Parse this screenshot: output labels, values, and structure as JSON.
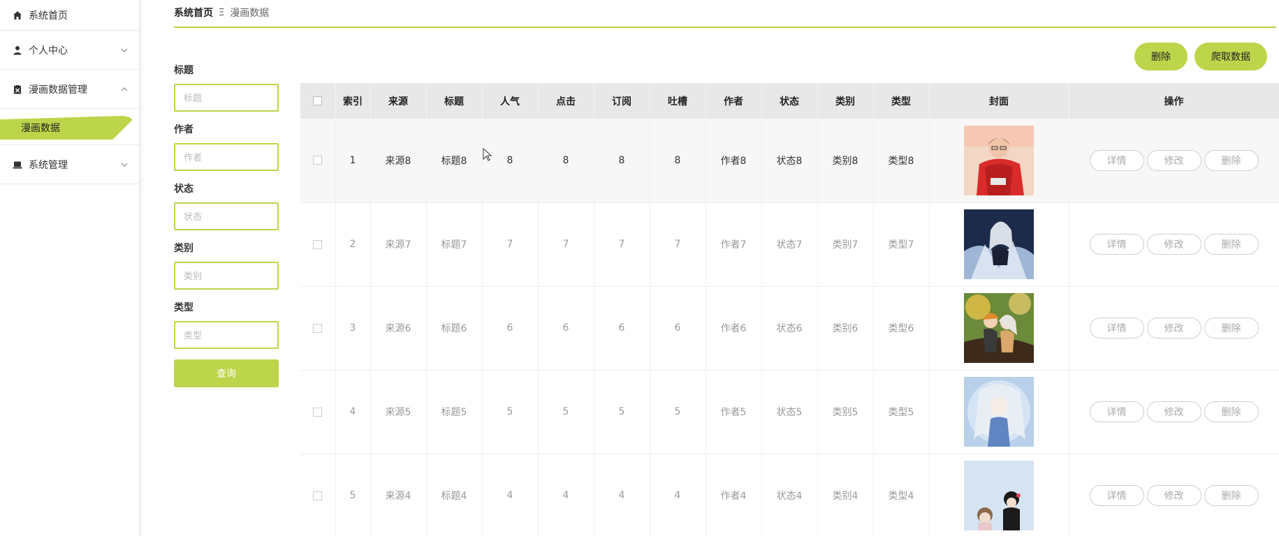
{
  "sidebar": {
    "items": [
      {
        "label": "系统首页",
        "icon": "home-icon"
      },
      {
        "label": "个人中心",
        "icon": "user-icon"
      },
      {
        "label": "漫画数据管理",
        "icon": "clipboard-icon"
      },
      {
        "label": "系统管理",
        "icon": "laptop-icon"
      }
    ],
    "active_sub": "漫画数据"
  },
  "breadcrumb": {
    "home": "系统首页",
    "separator": "Ξ",
    "current": "漫画数据"
  },
  "actions": {
    "delete_label": "删除",
    "crawl_label": "爬取数据"
  },
  "filters": {
    "title": {
      "label": "标题",
      "placeholder": "标题"
    },
    "author": {
      "label": "作者",
      "placeholder": "作者"
    },
    "status": {
      "label": "状态",
      "placeholder": "状态"
    },
    "category": {
      "label": "类别",
      "placeholder": "类别"
    },
    "type": {
      "label": "类型",
      "placeholder": "类型"
    },
    "query_label": "查询"
  },
  "table": {
    "headers": [
      "索引",
      "来源",
      "标题",
      "人气",
      "点击",
      "订阅",
      "吐槽",
      "作者",
      "状态",
      "类别",
      "类型",
      "封面",
      "操作"
    ],
    "rows": [
      {
        "index": "1",
        "source": "来源8",
        "title": "标题8",
        "popularity": "8",
        "clicks": "8",
        "subs": "8",
        "comments": "8",
        "author": "作者8",
        "status": "状态8",
        "category": "类别8",
        "type": "类型8"
      },
      {
        "index": "2",
        "source": "来源7",
        "title": "标题7",
        "popularity": "7",
        "clicks": "7",
        "subs": "7",
        "comments": "7",
        "author": "作者7",
        "status": "状态7",
        "category": "类别7",
        "type": "类型7"
      },
      {
        "index": "3",
        "source": "来源6",
        "title": "标题6",
        "popularity": "6",
        "clicks": "6",
        "subs": "6",
        "comments": "6",
        "author": "作者6",
        "status": "状态6",
        "category": "类别6",
        "type": "类型6"
      },
      {
        "index": "4",
        "source": "来源5",
        "title": "标题5",
        "popularity": "5",
        "clicks": "5",
        "subs": "5",
        "comments": "5",
        "author": "作者5",
        "status": "状态5",
        "category": "类别5",
        "type": "类型5"
      },
      {
        "index": "5",
        "source": "来源4",
        "title": "标题4",
        "popularity": "4",
        "clicks": "4",
        "subs": "4",
        "comments": "4",
        "author": "作者4",
        "status": "状态4",
        "category": "类别4",
        "type": "类型4"
      }
    ],
    "op_labels": {
      "detail": "详情",
      "edit": "修改",
      "delete": "删除"
    }
  },
  "colors": {
    "accent": "#bcd54a"
  }
}
